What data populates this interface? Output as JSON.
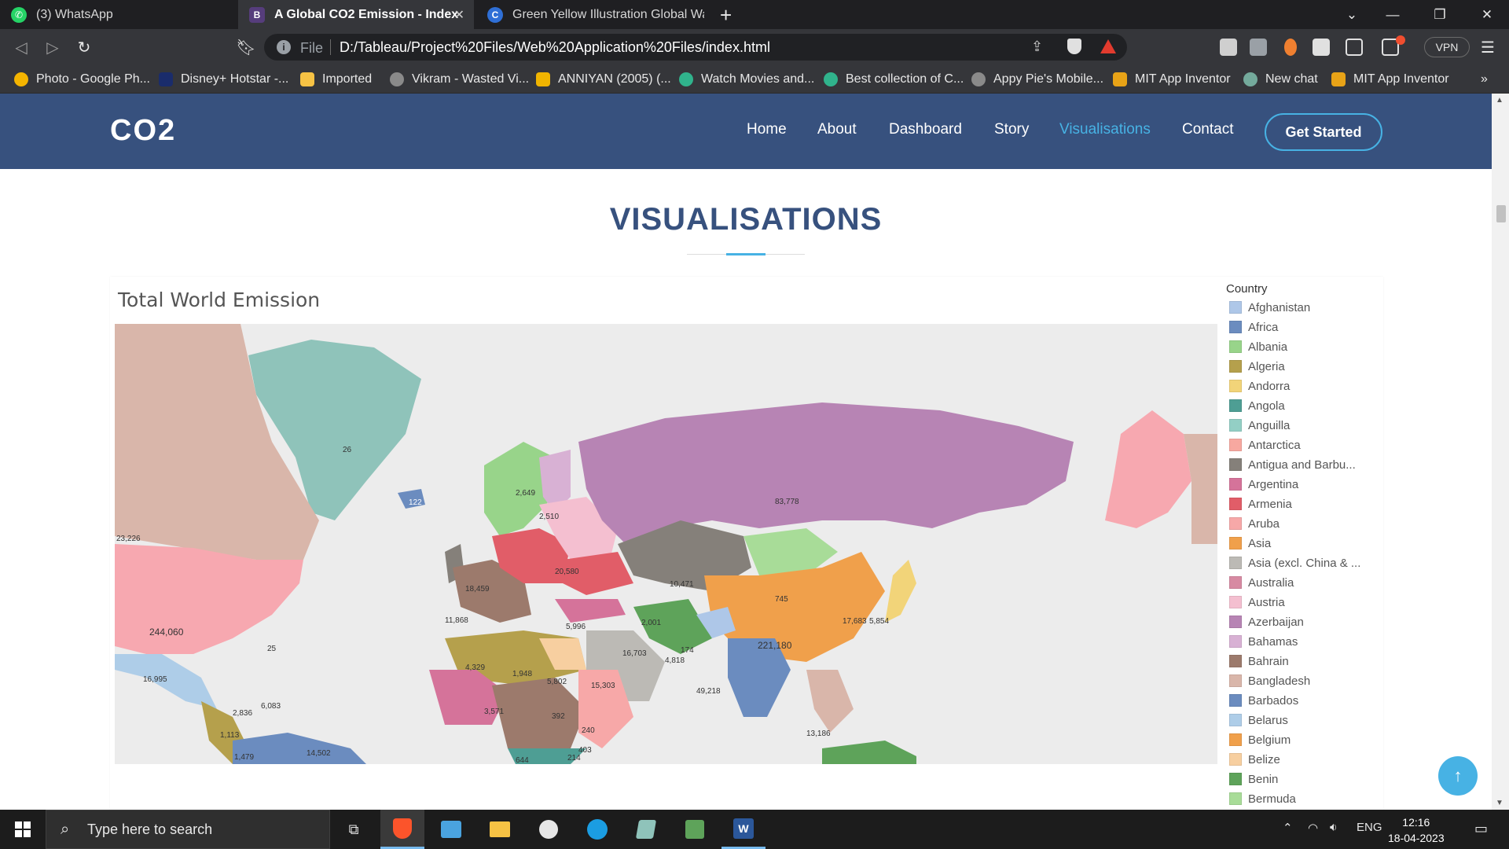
{
  "browser": {
    "tabs": [
      {
        "title": "(3) WhatsApp",
        "icon": "whatsapp-icon",
        "color": "#25d366"
      },
      {
        "title": "A Global CO2 Emission - Index",
        "icon": "bootstrap-icon",
        "color": "#563d7c"
      },
      {
        "title": "Green Yellow Illustration Global Warmi",
        "icon": "canva-icon",
        "color": "#2f6fd6"
      }
    ],
    "close_glyph": "✕",
    "newtab_glyph": "+",
    "file_label": "File",
    "url": "D:/Tableau/Project%20Files/Web%20Application%20Files/index.html",
    "vpn_label": "VPN",
    "bookmarks": [
      {
        "label": "Photo - Google Ph...",
        "color": "#f4b400"
      },
      {
        "label": "Disney+ Hotstar -...",
        "color": "#1a2c6b"
      },
      {
        "label": "Imported",
        "color": "#f6c244"
      },
      {
        "label": "Vikram - Wasted Vi...",
        "color": "#8a8a8a"
      },
      {
        "label": "ANNIYAN (2005) (...",
        "color": "#f0b400"
      },
      {
        "label": "Watch Movies and...",
        "color": "#30b38c"
      },
      {
        "label": "Best collection of C...",
        "color": "#30b38c"
      },
      {
        "label": "Appy Pie's Mobile...",
        "color": "#8a8a8a"
      },
      {
        "label": "MIT App Inventor",
        "color": "#e8a317"
      },
      {
        "label": "New chat",
        "color": "#74aa9c"
      },
      {
        "label": "MIT App Inventor",
        "color": "#e8a317"
      }
    ],
    "bookmarks_more": "»"
  },
  "site": {
    "logo": "CO2",
    "nav": [
      "Home",
      "About",
      "Dashboard",
      "Story",
      "Visualisations",
      "Contact"
    ],
    "active_nav": "Visualisations",
    "cta": "Get Started",
    "accent": "#47b2e4",
    "header_color": "#37517e"
  },
  "section": {
    "title": "VISUALISATIONS"
  },
  "viz": {
    "title": "Total World Emission",
    "map_labels": [
      "26",
      "23,226",
      "244,060",
      "16,995",
      "83,778",
      "221,180",
      "10,471",
      "745",
      "49,218",
      "15,303",
      "4,329",
      "1,948",
      "5,802",
      "16,703",
      "2,649",
      "2,510",
      "20,580",
      "18,459",
      "14,502",
      "13,186",
      "122",
      "25",
      "2,836",
      "6,083",
      "4,818",
      "5,996",
      "2,001",
      "174",
      "11,868",
      "1,113",
      "1,479",
      "3,571",
      "17,683",
      "5,854",
      "392",
      "240",
      "403",
      "644",
      "214"
    ],
    "legend_title": "Country",
    "legend": [
      {
        "name": "Afghanistan",
        "color": "#aec7e8"
      },
      {
        "name": "Africa",
        "color": "#6b8cbf"
      },
      {
        "name": "Albania",
        "color": "#98d48a"
      },
      {
        "name": "Algeria",
        "color": "#b5a04c"
      },
      {
        "name": "Andorra",
        "color": "#f2d479"
      },
      {
        "name": "Angola",
        "color": "#4e9e94"
      },
      {
        "name": "Anguilla",
        "color": "#93cfc5"
      },
      {
        "name": "Antarctica",
        "color": "#f7a8a0"
      },
      {
        "name": "Antigua and Barbu...",
        "color": "#85807a"
      },
      {
        "name": "Argentina",
        "color": "#d5739a"
      },
      {
        "name": "Armenia",
        "color": "#e15d68"
      },
      {
        "name": "Aruba",
        "color": "#f7a8a8"
      },
      {
        "name": "Asia",
        "color": "#f0a04b"
      },
      {
        "name": "Asia (excl. China & ...",
        "color": "#bcbab5"
      },
      {
        "name": "Australia",
        "color": "#d78aa2"
      },
      {
        "name": "Austria",
        "color": "#f4bfd0"
      },
      {
        "name": "Azerbaijan",
        "color": "#b784b4"
      },
      {
        "name": "Bahamas",
        "color": "#d8b1d4"
      },
      {
        "name": "Bahrain",
        "color": "#9c7a6c"
      },
      {
        "name": "Bangladesh",
        "color": "#d9b6aa"
      },
      {
        "name": "Barbados",
        "color": "#6b8cbf"
      },
      {
        "name": "Belarus",
        "color": "#aecde8"
      },
      {
        "name": "Belgium",
        "color": "#f0a04b"
      },
      {
        "name": "Belize",
        "color": "#f7cfa0"
      },
      {
        "name": "Benin",
        "color": "#5ea35a"
      },
      {
        "name": "Bermuda",
        "color": "#a8dc98"
      }
    ]
  },
  "taskbar": {
    "search_placeholder": "Type here to search",
    "language": "ENG",
    "time": "12:16",
    "date": "18-04-2023"
  }
}
